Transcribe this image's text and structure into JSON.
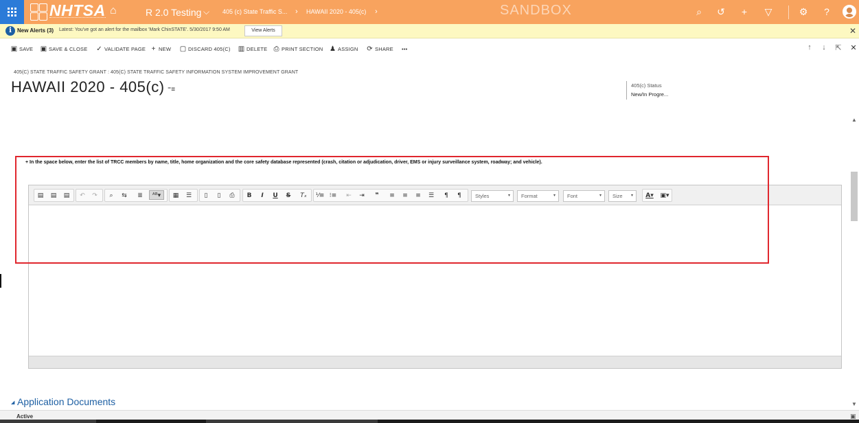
{
  "nav": {
    "logo": "NHTSA",
    "app_name": "R 2.0 Testing",
    "breadcrumb_1": "405 (c) State Traffic S...",
    "breadcrumb_2": "HAWAII 2020 - 405(c)",
    "environment": "SANDBOX",
    "colors": {
      "bar": "#f8a35e",
      "waffle": "#2b7bd8"
    }
  },
  "alert": {
    "title": "New Alerts (3)",
    "message": "Latest: You've got an alert for the mailbox 'Mark ChinSTATE'. 5/30/2017 9:50 AM",
    "button": "View Alerts"
  },
  "commands": [
    {
      "icon": "save-icon",
      "label": "SAVE"
    },
    {
      "icon": "save-close-icon",
      "label": "SAVE & CLOSE"
    },
    {
      "icon": "validate-icon",
      "label": "VALIDATE PAGE"
    },
    {
      "icon": "plus-icon",
      "label": "NEW"
    },
    {
      "icon": "discard-icon",
      "label": "DISCARD 405(C)"
    },
    {
      "icon": "trash-icon",
      "label": "DELETE"
    },
    {
      "icon": "print-icon",
      "label": "PRINT SECTION"
    },
    {
      "icon": "assign-icon",
      "label": "ASSIGN"
    },
    {
      "icon": "share-icon",
      "label": "SHARE"
    },
    {
      "icon": "more-icon",
      "label": "•••"
    }
  ],
  "record": {
    "entity_type": "405(C) STATE TRAFFIC SAFETY GRANT : 405(C) STATE TRAFFIC SAFETY INFORMATION SYSTEM IMPROVEMENT GRANT",
    "title": "HAWAII 2020 - 405(c)",
    "status_label": "405(c) Status",
    "status_value": "New/In Progre..."
  },
  "question": {
    "text": "+ In the space below, enter the list of TRCC members by name, title, home organization and the core safety database represented (crash, citation or adjudication, driver, EMS or injury surveillance system, roadway; and vehicle)."
  },
  "editor": {
    "combos": {
      "styles": "Styles",
      "format": "Format",
      "font": "Font",
      "size": "Size"
    },
    "content": ""
  },
  "section": {
    "title": "Application Documents"
  },
  "footer": {
    "status": "Active"
  },
  "highlight_color": "#e0262d"
}
